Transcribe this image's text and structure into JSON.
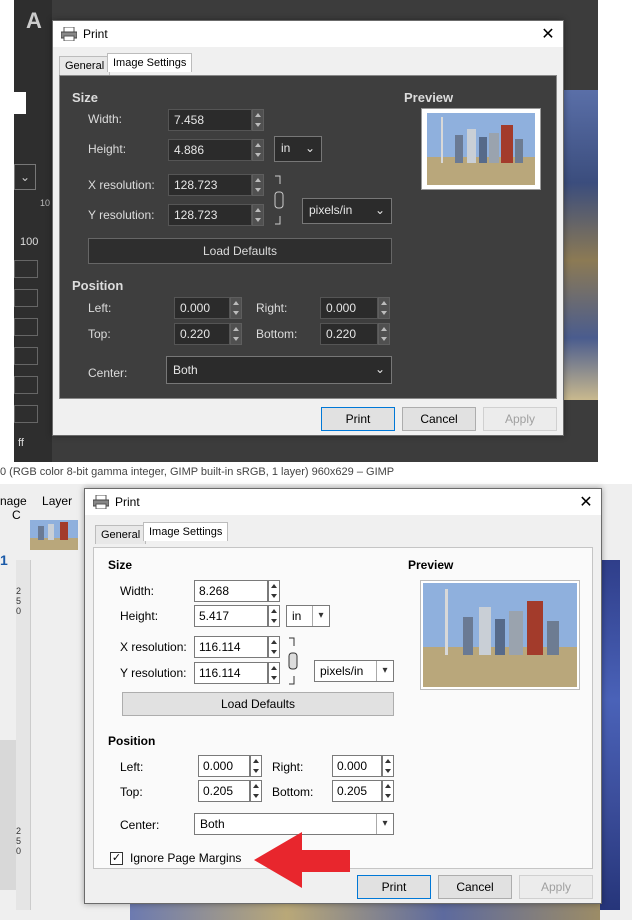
{
  "top": {
    "window_title": "Print",
    "tabs": [
      "General",
      "Image Settings"
    ],
    "size_heading": "Size",
    "width_label": "Width:",
    "width_value": "7.458",
    "height_label": "Height:",
    "height_value": "4.886",
    "unit": "in",
    "xres_label": "X resolution:",
    "xres_value": "128.723",
    "yres_label": "Y resolution:",
    "yres_value": "128.723",
    "res_unit": "pixels/in",
    "load_defaults": "Load Defaults",
    "position_heading": "Position",
    "left_label": "Left:",
    "left_value": "0.000",
    "right_label": "Right:",
    "right_value": "0.000",
    "top_label": "Top:",
    "top_value": "0.220",
    "bottom_label": "Bottom:",
    "bottom_value": "0.220",
    "center_label": "Center:",
    "center_value": "Both",
    "preview_heading": "Preview",
    "print_btn": "Print",
    "cancel_btn": "Cancel",
    "apply_btn": "Apply"
  },
  "status_bar": "0 (RGB color 8-bit gamma integer, GIMP built-in sRGB, 1 layer) 960x629 – GIMP",
  "gimp_left": {
    "tool_text": "A",
    "ruler_mark": "10",
    "field_100": "100",
    "field_ff": "ff",
    "ruler2": "1"
  },
  "bottom": {
    "menu_image": "nage",
    "menu_layer": "Layer",
    "menu_c": "C",
    "window_title": "Print",
    "tabs": [
      "General",
      "Image Settings"
    ],
    "size_heading": "Size",
    "width_label": "Width:",
    "width_value": "8.268",
    "height_label": "Height:",
    "height_value": "5.417",
    "unit": "in",
    "xres_label": "X resolution:",
    "xres_value": "116.114",
    "yres_label": "Y resolution:",
    "yres_value": "116.114",
    "res_unit": "pixels/in",
    "load_defaults": "Load Defaults",
    "position_heading": "Position",
    "left_label": "Left:",
    "left_value": "0.000",
    "right_label": "Right:",
    "right_value": "0.000",
    "top_label": "Top:",
    "top_value": "0.205",
    "bottom_label": "Bottom:",
    "bottom_value": "0.205",
    "center_label": "Center:",
    "center_value": "Both",
    "ignore_margins": "Ignore Page Margins",
    "ignore_margins_checked": true,
    "preview_heading": "Preview",
    "print_btn": "Print",
    "cancel_btn": "Cancel",
    "apply_btn": "Apply",
    "ruler_numbers": [
      "2",
      "5",
      "0",
      "2",
      "5",
      "0"
    ]
  },
  "colors": {
    "arrow": "#e8262d",
    "dark_panel": "#3e3e3e",
    "focus_blue": "#0078d7"
  }
}
